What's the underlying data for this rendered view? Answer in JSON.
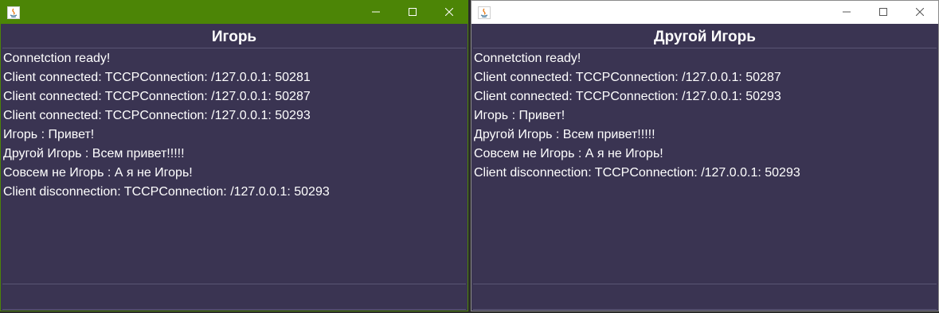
{
  "windows": [
    {
      "heading": "Игорь",
      "log": [
        "Connetction ready!",
        "Client connected: TCCPConnection: /127.0.0.1: 50281",
        "Client connected: TCCPConnection: /127.0.0.1: 50287",
        "Client connected: TCCPConnection: /127.0.0.1: 50293",
        "Игорь : Привет!",
        "Другой Игорь : Всем привет!!!!!",
        "Совсем не Игорь : А я не Игорь!",
        "Client disconnection: TCCPConnection: /127.0.0.1: 50293"
      ],
      "message_input_value": "",
      "titlebar_color": "#4c8506"
    },
    {
      "heading": "Другой Игорь",
      "log": [
        "Connetction ready!",
        "Client connected: TCCPConnection: /127.0.0.1: 50287",
        "Client connected: TCCPConnection: /127.0.0.1: 50293",
        "Игорь : Привет!",
        "Другой Игорь : Всем привет!!!!!",
        "Совсем не Игорь : А я не Игорь!",
        "Client disconnection: TCCPConnection: /127.0.0.1: 50293"
      ],
      "message_input_value": "",
      "titlebar_color": "#ffffff"
    }
  ],
  "icons": {
    "app": "java-icon",
    "minimize": "minimize-icon",
    "maximize": "maximize-icon",
    "close": "close-icon"
  },
  "colors": {
    "background": "#3a3452",
    "text": "#ffffff",
    "active_titlebar": "#4c8506"
  }
}
